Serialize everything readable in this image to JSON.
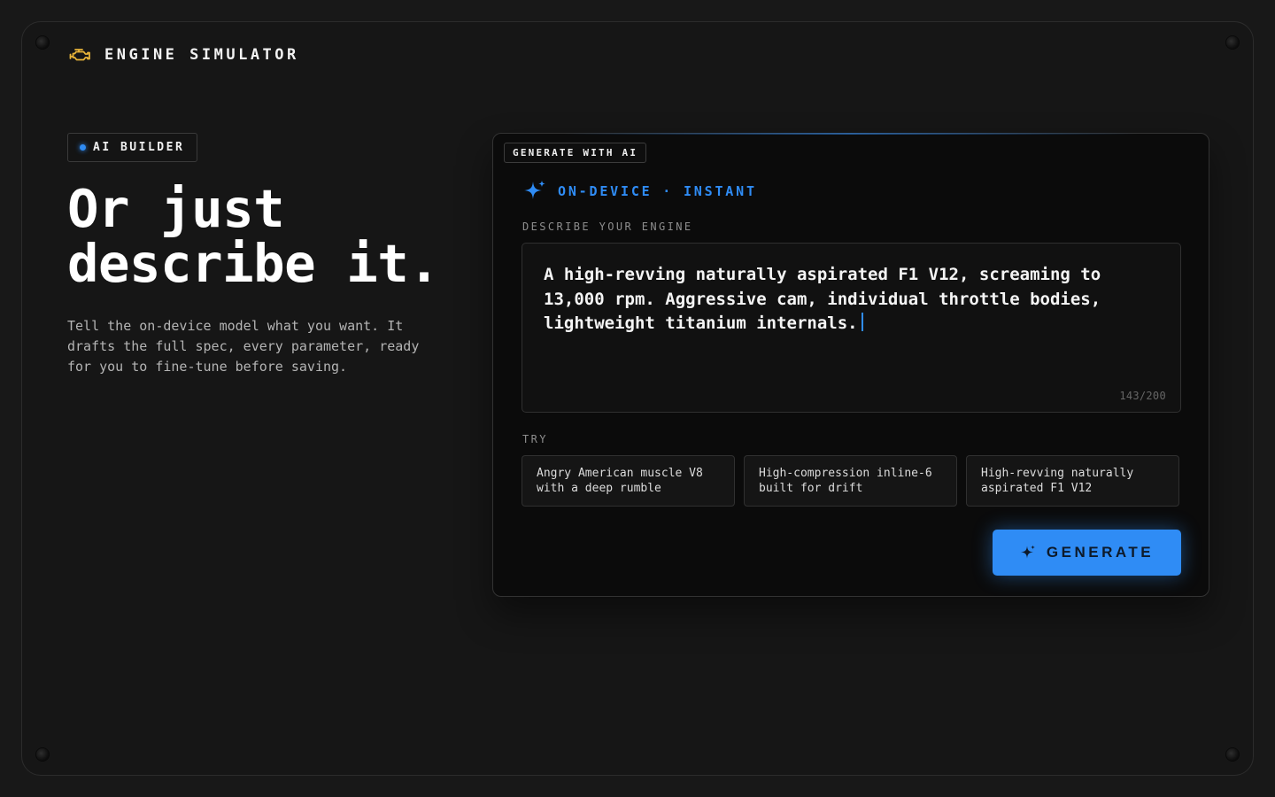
{
  "header": {
    "icon": "engine-icon",
    "title": "ENGINE SIMULATOR"
  },
  "hero": {
    "badge": "AI BUILDER",
    "headline": "Or just\ndescribe it.",
    "description": "Tell the on-device model what you want. It drafts the full spec, every parameter, ready for you to fine-tune before saving."
  },
  "card": {
    "tab_label": "GENERATE WITH AI",
    "ai_line": "ON-DEVICE · INSTANT",
    "field_label": "DESCRIBE YOUR ENGINE",
    "prompt_value": "A high-revving naturally aspirated F1 V12, screaming to 13,000 rpm. Aggressive cam, individual throttle bodies, lightweight titanium internals.",
    "counter": "143/200",
    "try_label": "TRY",
    "suggestions": [
      "Angry American muscle V8 with a deep rumble",
      "High-compression inline-6 built for drift",
      "High-revving naturally aspirated F1 V12"
    ],
    "generate_label": "GENERATE"
  },
  "colors": {
    "accent": "#2f8cf5",
    "engine_icon": "#e8b43a",
    "background": "#181818",
    "card": "#0b0b0b"
  }
}
